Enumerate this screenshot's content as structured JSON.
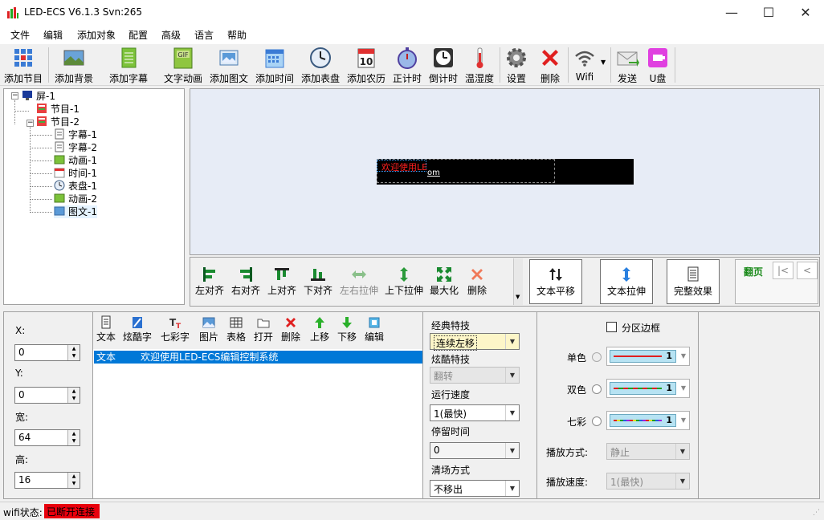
{
  "window": {
    "title": "LED-ECS V6.1.3 Svn:265",
    "minimize": "—",
    "maximize": "☐",
    "close": "✕"
  },
  "menu": [
    "文件",
    "编辑",
    "添加对象",
    "配置",
    "高级",
    "语言",
    "帮助"
  ],
  "toolbar": [
    {
      "label": "添加节目",
      "icon": "grid-icon"
    },
    {
      "label": "添加背景",
      "icon": "background-image-icon"
    },
    {
      "label": "添加字幕",
      "icon": "document-icon"
    },
    {
      "label": "文字动画",
      "icon": "gif-icon"
    },
    {
      "label": "添加图文",
      "icon": "picture-icon"
    },
    {
      "label": "添加时间",
      "icon": "calendar-icon"
    },
    {
      "label": "添加表盘",
      "icon": "clock-icon"
    },
    {
      "label": "添加农历",
      "icon": "lunar-calendar-icon"
    },
    {
      "label": "正计时",
      "icon": "stopwatch-icon"
    },
    {
      "label": "倒计时",
      "icon": "countdown-icon"
    },
    {
      "label": "温湿度",
      "icon": "thermometer-icon"
    },
    {
      "label": "设置",
      "icon": "gear-icon"
    },
    {
      "label": "删除",
      "icon": "delete-icon"
    },
    {
      "label": "Wifi",
      "icon": "wifi-icon"
    },
    {
      "label": "发送",
      "icon": "send-icon"
    },
    {
      "label": "U盘",
      "icon": "usb-icon"
    }
  ],
  "tree": {
    "root": "屏-1",
    "program1": "节目-1",
    "program2": "节目-2",
    "children": [
      "字幕-1",
      "字幕-2",
      "动画-1",
      "时间-1",
      "表盘-1",
      "动画-2",
      "图文-1"
    ]
  },
  "preview": {
    "led_text": "欢迎使用LE",
    "led_tail": "om"
  },
  "alignbar": {
    "items": [
      "左对齐",
      "右对齐",
      "上对齐",
      "下对齐",
      "左右拉伸",
      "上下拉伸",
      "最大化",
      "删除"
    ],
    "text_pan": "文本平移",
    "text_stretch": "文本拉伸",
    "full_effect": "完整效果",
    "page_label": "翻页",
    "first_btn": "|<",
    "prev_btn": "<"
  },
  "position": {
    "x_label": "X:",
    "x": "0",
    "y_label": "Y:",
    "y": "0",
    "w_label": "宽:",
    "w": "64",
    "h_label": "高:",
    "h": "16"
  },
  "textpanel": {
    "tools": [
      "文本",
      "炫酷字",
      "七彩字",
      "图片",
      "表格",
      "打开",
      "删除",
      "上移",
      "下移",
      "编辑"
    ],
    "row_type": "文本",
    "row_content": "欢迎使用LED-ECS编辑控制系统"
  },
  "effects": {
    "classic_label": "经典特技",
    "classic_value": "连续左移",
    "cool_label": "炫酷特技",
    "cool_value": "翻转",
    "speed_label": "运行速度",
    "speed_value": "1(最快)",
    "stay_label": "停留时间",
    "stay_value": "0",
    "clear_label": "清场方式",
    "clear_value": "不移出"
  },
  "border": {
    "checkbox_label": "分区边框",
    "single_label": "单色",
    "single_value": "1",
    "dual_label": "双色",
    "dual_value": "1",
    "color_label": "七彩",
    "color_value": "1",
    "mode_label": "播放方式:",
    "mode_value": "静止",
    "speed_label": "播放速度:",
    "speed_value": "1(最快)"
  },
  "status": {
    "label": "wifi状态:",
    "value": "已断开连接"
  },
  "colors": {
    "status_bg": "#e8000d",
    "selection": "#0078d7",
    "led_red": "#ff2020"
  }
}
